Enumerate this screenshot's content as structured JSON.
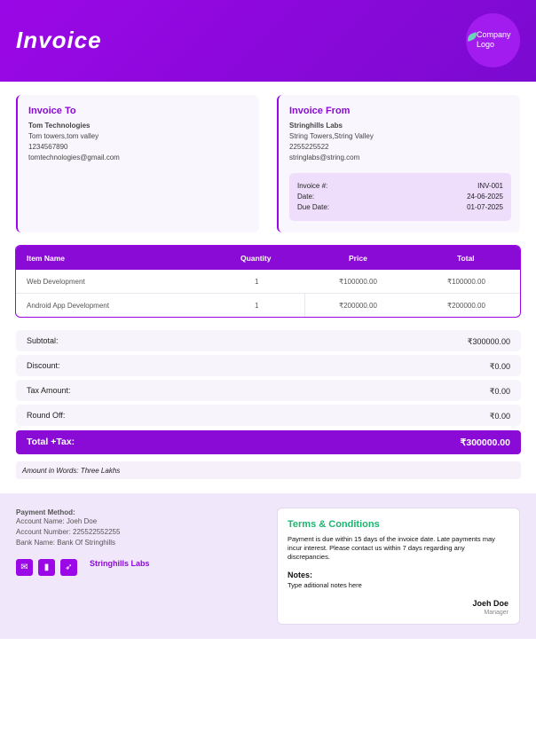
{
  "header": {
    "title": "Invoice",
    "logo_text": "Company Logo"
  },
  "invoice_to": {
    "heading": "Invoice To",
    "name": "Tom Technologies",
    "address": "Tom towers,tom valley",
    "phone": "1234567890",
    "email": "tomtechnologies@gmail.com"
  },
  "invoice_from": {
    "heading": "Invoice From",
    "name": "Stringhills Labs",
    "address": "String Towers,String Valley",
    "phone": "2255225522",
    "email": "stringlabs@string.com"
  },
  "meta": [
    {
      "label": "Invoice #:",
      "value": "INV-001"
    },
    {
      "label": "Date:",
      "value": "24-06-2025"
    },
    {
      "label": "Due Date:",
      "value": "01-07-2025"
    }
  ],
  "table": {
    "headers": [
      "Item Name",
      "Quantity",
      "Price",
      "Total"
    ],
    "rows": [
      [
        "Web Development",
        "1",
        "₹100000.00",
        "₹100000.00"
      ],
      [
        "Android App Development",
        "1",
        "₹200000.00",
        "₹200000.00"
      ]
    ]
  },
  "summary": [
    {
      "label": "Subtotal:",
      "value": "₹300000.00"
    },
    {
      "label": "Discount:",
      "value": "₹0.00"
    },
    {
      "label": "Tax Amount:",
      "value": "₹0.00"
    },
    {
      "label": "Round Off:",
      "value": "₹0.00"
    }
  ],
  "total": {
    "label": "Total +Tax:",
    "value": "₹300000.00"
  },
  "amount_in_words": "Amount in Words: Three Lakhs",
  "payment": {
    "title": "Payment Method:",
    "account_name": "Account Name: Joeh Doe",
    "account_number": "Account Number: 225522552255",
    "bank_name": "Bank Name: Bank Of Stringhills"
  },
  "social_icons": [
    "email-icon",
    "facebook-icon",
    "twitter-icon"
  ],
  "brand_name": "Stringhills Labs",
  "terms": {
    "heading": "Terms & Conditions",
    "body": "Payment is due within 15 days of the invoice date. Late payments may incur interest. Please contact us within 7 days regarding any discrepancies.",
    "notes_heading": "Notes:",
    "notes": "Type aditional notes here",
    "signer": "Joeh Doe",
    "role": "Manager"
  },
  "colors": {
    "accent": "#8b0bd6",
    "terms_heading": "#1bb56f",
    "footer_bg": "#f1e7fa"
  }
}
